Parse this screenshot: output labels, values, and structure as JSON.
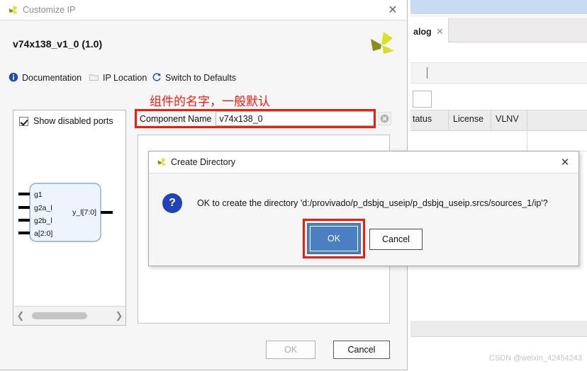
{
  "background_window": {
    "tab_label": "alog",
    "tab_close_icon": "close-icon",
    "columns": [
      "tatus",
      "License",
      "VLNV"
    ],
    "watermark": "CSDN @weixin_42454243"
  },
  "customize_ip": {
    "title": "Customize IP",
    "title_logo_icon": "xilinx-logo-icon",
    "close_icon": "close-icon",
    "ip_name": "v74x138_v1_0 (1.0)",
    "header_logo_icon": "xilinx-logo-icon",
    "toolbar": [
      {
        "label": "Documentation",
        "icon": "info-icon"
      },
      {
        "label": "IP Location",
        "icon": "folder-icon"
      },
      {
        "label": "Switch to Defaults",
        "icon": "refresh-icon"
      }
    ],
    "show_disabled_ports": {
      "label": "Show disabled ports",
      "checked": true
    },
    "diagram": {
      "module_inputs": [
        "g1",
        "g2a_l",
        "g2b_l",
        "a[2:0]"
      ],
      "module_outputs": [
        "y_l[7:0]"
      ]
    },
    "component_name": {
      "label": "Component Name",
      "value": "v74x138_0",
      "clear_icon": "clear-circle-icon"
    },
    "footer": {
      "ok_label": "OK",
      "cancel_label": "Cancel"
    },
    "scrollbar": {
      "left_arrow_icon": "chevron-left-icon",
      "right_arrow_icon": "chevron-right-icon"
    }
  },
  "annotations": {
    "component_name_note": "组件的名字，一般默认",
    "color": "#f41b0c"
  },
  "create_directory_dialog": {
    "title": "Create Directory",
    "title_logo_icon": "xilinx-logo-icon",
    "close_icon": "close-icon",
    "question_icon": "question-mark-icon",
    "message": "OK to create the directory 'd:/provivado/p_dsbjq_useip/p_dsbjq_useip.srcs/sources_1/ip'?",
    "ok_label": "OK",
    "cancel_label": "Cancel",
    "ok_accent_color": "#4a7fc1"
  }
}
